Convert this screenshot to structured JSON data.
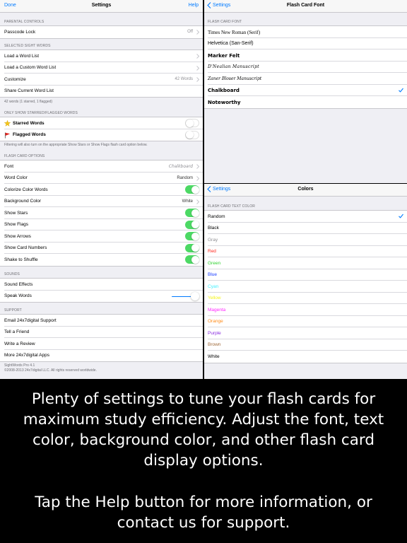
{
  "settings": {
    "nav": {
      "left": "Done",
      "title": "Settings",
      "right": "Help"
    },
    "parental": {
      "header": "Parental Controls",
      "rows": [
        {
          "label": "Passcode Lock",
          "value": "Off"
        }
      ]
    },
    "sight_words": {
      "header": "Selected Sight Words",
      "rows": [
        {
          "label": "Load a Word List"
        },
        {
          "label": "Load a Custom Word List"
        },
        {
          "label": "Customize",
          "value": "42 Words"
        },
        {
          "label": "Share Current Word List"
        }
      ],
      "footer": "42 words (1 starred, 1 flagged)"
    },
    "starred": {
      "header": "Only Show Starred/Flagged Words",
      "rows": [
        {
          "label": "Starred Words",
          "icon": "star-icon",
          "state": "off"
        },
        {
          "label": "Flagged Words",
          "icon": "flag-icon",
          "state": "off"
        }
      ],
      "footer": "Filtering will also turn on the appropriate Show Stars or Show Flags flash card option below."
    },
    "flash_card_options": {
      "header": "Flash Card Options",
      "rows": [
        {
          "label": "Font",
          "value": "Chalkboard",
          "type": "disclosure"
        },
        {
          "label": "Word Color",
          "value": "Random",
          "type": "disclosure"
        },
        {
          "label": "Colorize Color Words",
          "type": "toggle",
          "state": "on"
        },
        {
          "label": "Background Color",
          "value": "White",
          "type": "disclosure"
        },
        {
          "label": "Show Stars",
          "type": "toggle",
          "state": "on"
        },
        {
          "label": "Show Flags",
          "type": "toggle",
          "state": "on"
        },
        {
          "label": "Show Arrows",
          "type": "toggle",
          "state": "on"
        },
        {
          "label": "Show Card Numbers",
          "type": "toggle",
          "state": "on"
        },
        {
          "label": "Shake to Shuffle",
          "type": "toggle",
          "state": "on"
        }
      ]
    },
    "sounds": {
      "header": "Sounds",
      "rows": [
        {
          "label": "Sound Effects"
        },
        {
          "label": "Speak Words",
          "slider_level": 0.92
        }
      ]
    },
    "support": {
      "header": "Support",
      "rows": [
        {
          "label": "Email 24x7digital Support"
        },
        {
          "label": "Tell a Friend"
        },
        {
          "label": "Write a Review"
        },
        {
          "label": "More 24x7digital Apps"
        }
      ],
      "footer_line1": "SightWords Pro 4.1",
      "footer_line2": "©2008-2013 24x7digital LLC. All rights reserved worldwide."
    }
  },
  "font_panel": {
    "nav": {
      "back": "Settings",
      "title": "Flash Card Font"
    },
    "header": "Flash Card Font",
    "fonts": [
      {
        "label": "Times New Roman (Serif)",
        "selected": false
      },
      {
        "label": "Helvetica (San-Serif)",
        "selected": false
      },
      {
        "label": "Marker Felt",
        "selected": false
      },
      {
        "label": "D'Nealian Manuscript",
        "selected": false
      },
      {
        "label": "Zaner Bloser Manuscript",
        "selected": false
      },
      {
        "label": "Chalkboard",
        "selected": true
      },
      {
        "label": "Noteworthy",
        "selected": false
      }
    ]
  },
  "colors_panel": {
    "nav": {
      "back": "Settings",
      "title": "Colors"
    },
    "header": "Flash Card Text Color",
    "colors": [
      {
        "label": "Random",
        "color": "#000000",
        "selected": true
      },
      {
        "label": "Black",
        "color": "#000000",
        "selected": false
      },
      {
        "label": "Gray",
        "color": "#8e8e93",
        "selected": false
      },
      {
        "label": "Red",
        "color": "#ff2a1f",
        "selected": false
      },
      {
        "label": "Green",
        "color": "#2ed12e",
        "selected": false
      },
      {
        "label": "Blue",
        "color": "#1a3dff",
        "selected": false
      },
      {
        "label": "Cyan",
        "color": "#3ff0ff",
        "selected": false
      },
      {
        "label": "Yellow",
        "color": "#f4f418",
        "selected": false
      },
      {
        "label": "Magenta",
        "color": "#ff28ff",
        "selected": false
      },
      {
        "label": "Orange",
        "color": "#ff8c1a",
        "selected": false
      },
      {
        "label": "Purple",
        "color": "#8a2de0",
        "selected": false
      },
      {
        "label": "Brown",
        "color": "#a06a3a",
        "selected": false
      },
      {
        "label": "White",
        "color": "#000000",
        "selected": false
      }
    ]
  },
  "caption": {
    "paragraph1": "Plenty of settings to tune your flash cards for maximum study efficiency.  Adjust the font, text color, background color, and other flash card display options.",
    "paragraph2": "Tap the Help button for more information, or contact us for support."
  },
  "colors": {
    "accent": "#007aff",
    "toggle_on": "#4cd964",
    "group_bg": "#efeff4"
  }
}
